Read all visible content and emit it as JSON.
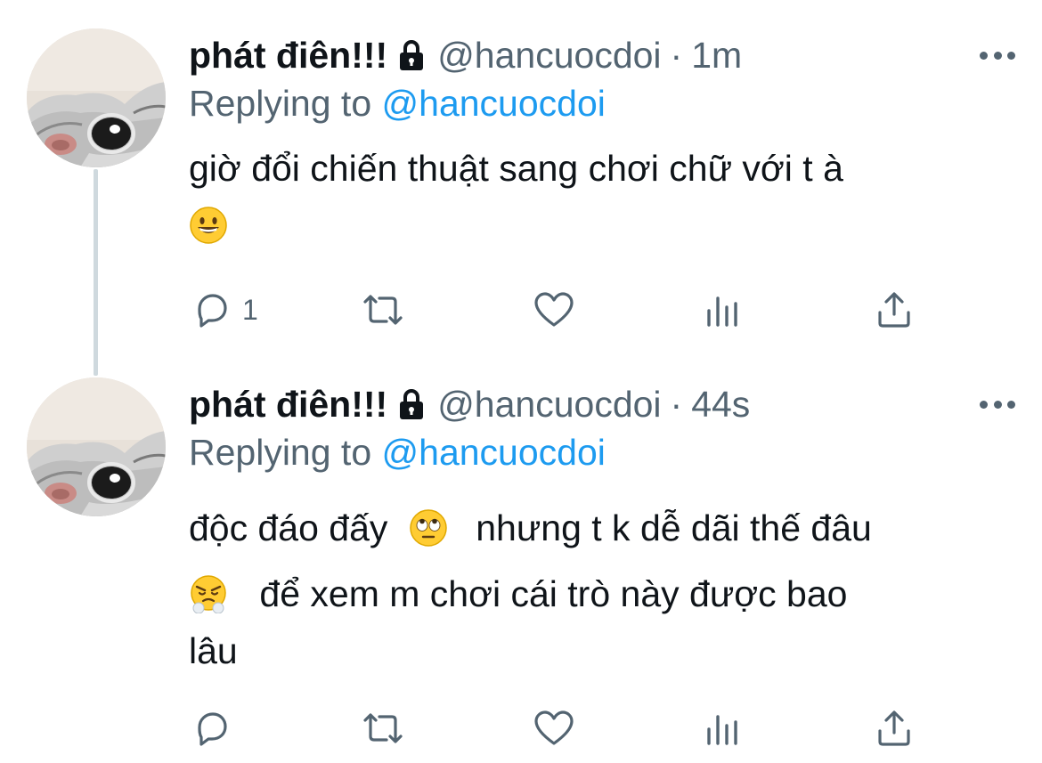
{
  "tweets": [
    {
      "name": "phát điên!!!",
      "handle": "@hancuocdoi",
      "separator": "·",
      "time": "1m",
      "replying_prefix": "Replying to ",
      "replying_to": "@hancuocdoi",
      "lines": [
        "giờ đổi chiến thuật sang chơi chữ với t à"
      ],
      "reply_count": "1",
      "icons": [
        "lock-icon",
        "grinning-emoji",
        "reply-icon",
        "retweet-icon",
        "like-icon",
        "views-icon",
        "share-icon",
        "more-icon"
      ]
    },
    {
      "name": "phát điên!!!",
      "handle": "@hancuocdoi",
      "separator": "·",
      "time": "44s",
      "replying_prefix": "Replying to ",
      "replying_to": "@hancuocdoi",
      "lines": [
        "độc đáo đấy",
        "nhưng t k dễ dãi thế đâu",
        "để xem m chơi cái trò này được bao",
        "lâu"
      ],
      "reply_count": "",
      "icons": [
        "lock-icon",
        "eye-roll-emoji",
        "steam-nose-emoji",
        "reply-icon",
        "retweet-icon",
        "like-icon",
        "views-icon",
        "share-icon",
        "more-icon"
      ]
    }
  ],
  "colors": {
    "text": "#0f1419",
    "secondary": "#536471",
    "link": "#1d9bf0",
    "thread_line": "#cfd9de"
  }
}
